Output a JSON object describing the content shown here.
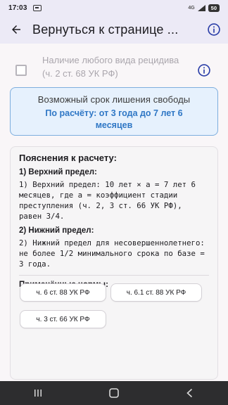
{
  "status": {
    "time": "17:03",
    "signal": "4G",
    "battery": "50"
  },
  "app_bar": {
    "title": "Вернуться к странице ..."
  },
  "option": {
    "label_plain": "Наличие любого вида рецидива (",
    "label_ref": "ч. 2 ст. 68 УК РФ",
    "label_end": ")"
  },
  "result": {
    "title": "Возможный срок лишения свободы",
    "value": "По расчёту: от 3 года до 7 лет 6 месяцев"
  },
  "explanation": {
    "title": "Пояснения к расчету:",
    "upper_head": "1) Верхний предел:",
    "upper_text": "1) Верхний предел: 10 лет × a = 7 лет 6 месяцев, где a = коэффициент стадии преступления (ч. 2, 3 ст. 66 УК РФ), равен 3/4.",
    "lower_head": "2) Нижний предел:",
    "lower_text": "2) Нижний предел для несовершеннолетнего: не более 1/2 минимального срока по базе = 3 года.",
    "norms_head": "Применённые нормы:",
    "norms": [
      "ч. 6 ст. 88 УК РФ",
      "ч. 6.1 ст. 88 УК РФ",
      "ч. 3 ст. 66 УК РФ"
    ]
  },
  "icons": {
    "back": "arrow-back-icon",
    "info": "info-icon",
    "nav_recent": "recent-apps-icon",
    "nav_home": "home-icon",
    "nav_back": "nav-back-icon"
  },
  "colors": {
    "accent": "#2f77c5",
    "result_bg": "#e6f1fd",
    "result_border": "#7eaede",
    "app_bar": "#eceaf6",
    "nav_bar": "#2d2d2f"
  }
}
